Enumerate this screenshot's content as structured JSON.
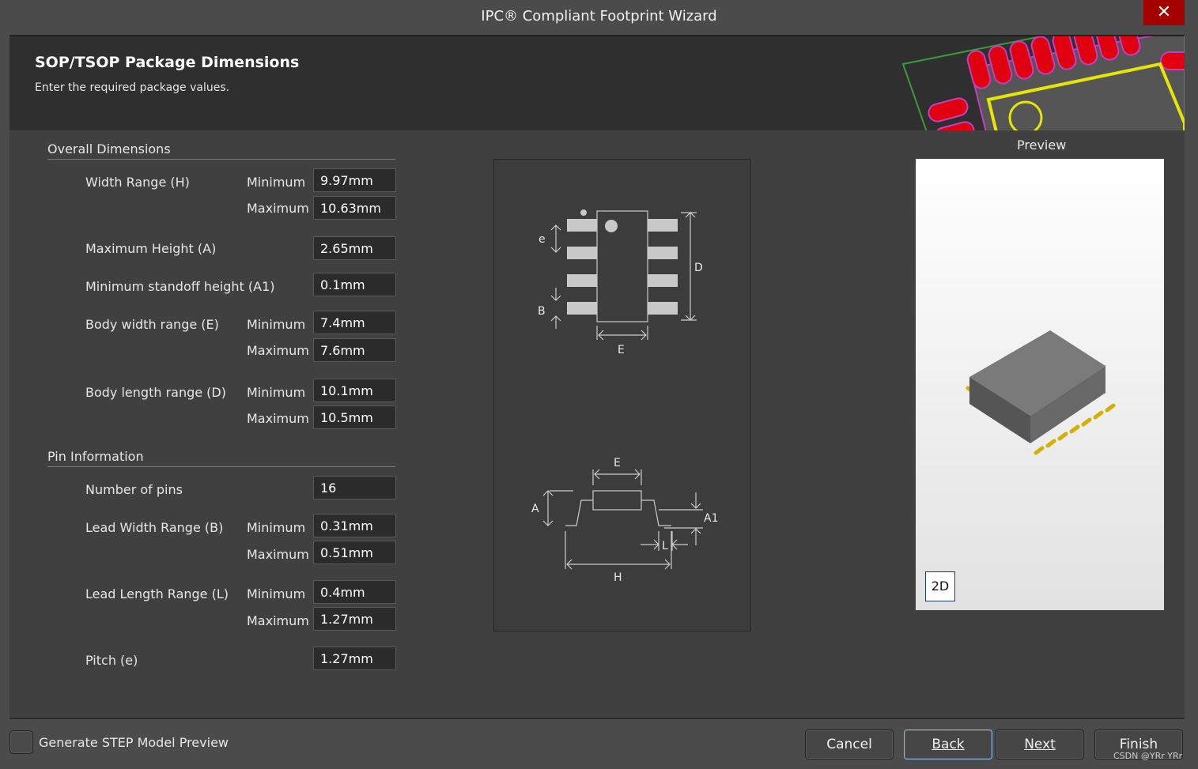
{
  "window": {
    "title": "IPC® Compliant Footprint Wizard",
    "close_label": "✕"
  },
  "header": {
    "title": "SOP/TSOP Package Dimensions",
    "subtitle": "Enter the required package values."
  },
  "sections": {
    "overall": "Overall Dimensions",
    "pins": "Pin Information"
  },
  "min_label": "Minimum",
  "max_label": "Maximum",
  "fields": {
    "width_range": {
      "label": "Width Range (H)",
      "min": "9.97mm",
      "max": "10.63mm"
    },
    "max_height": {
      "label": "Maximum Height (A)",
      "value": "2.65mm"
    },
    "min_standoff": {
      "label": "Minimum standoff height (A1)",
      "value": "0.1mm"
    },
    "body_width": {
      "label": "Body width range (E)",
      "min": "7.4mm",
      "max": "7.6mm"
    },
    "body_length": {
      "label": "Body length range (D)",
      "min": "10.1mm",
      "max": "10.5mm"
    },
    "num_pins": {
      "label": "Number of pins",
      "value": "16"
    },
    "lead_width": {
      "label": "Lead Width Range (B)",
      "min": "0.31mm",
      "max": "0.51mm"
    },
    "lead_length": {
      "label": "Lead Length Range (L)",
      "min": "0.4mm",
      "max": "1.27mm"
    },
    "pitch": {
      "label": "Pitch (e)",
      "value": "1.27mm"
    }
  },
  "diagram": {
    "e": "e",
    "B": "B",
    "D": "D",
    "E": "E",
    "A": "A",
    "A1": "A1",
    "L": "L",
    "H": "H"
  },
  "preview": {
    "label": "Preview",
    "mode_button": "2D"
  },
  "footer": {
    "step_checkbox": "Generate STEP Model Preview",
    "checked": false,
    "cancel": "Cancel",
    "back": "Back",
    "next": "Next",
    "finish": "Finish",
    "watermark": "CSDN @YRr YRr"
  },
  "colors": {
    "close": "#a50000",
    "pad": "#e00010",
    "silk": "#e6e600",
    "lead": "#d4b000",
    "body3d": "#6a6a6a"
  }
}
